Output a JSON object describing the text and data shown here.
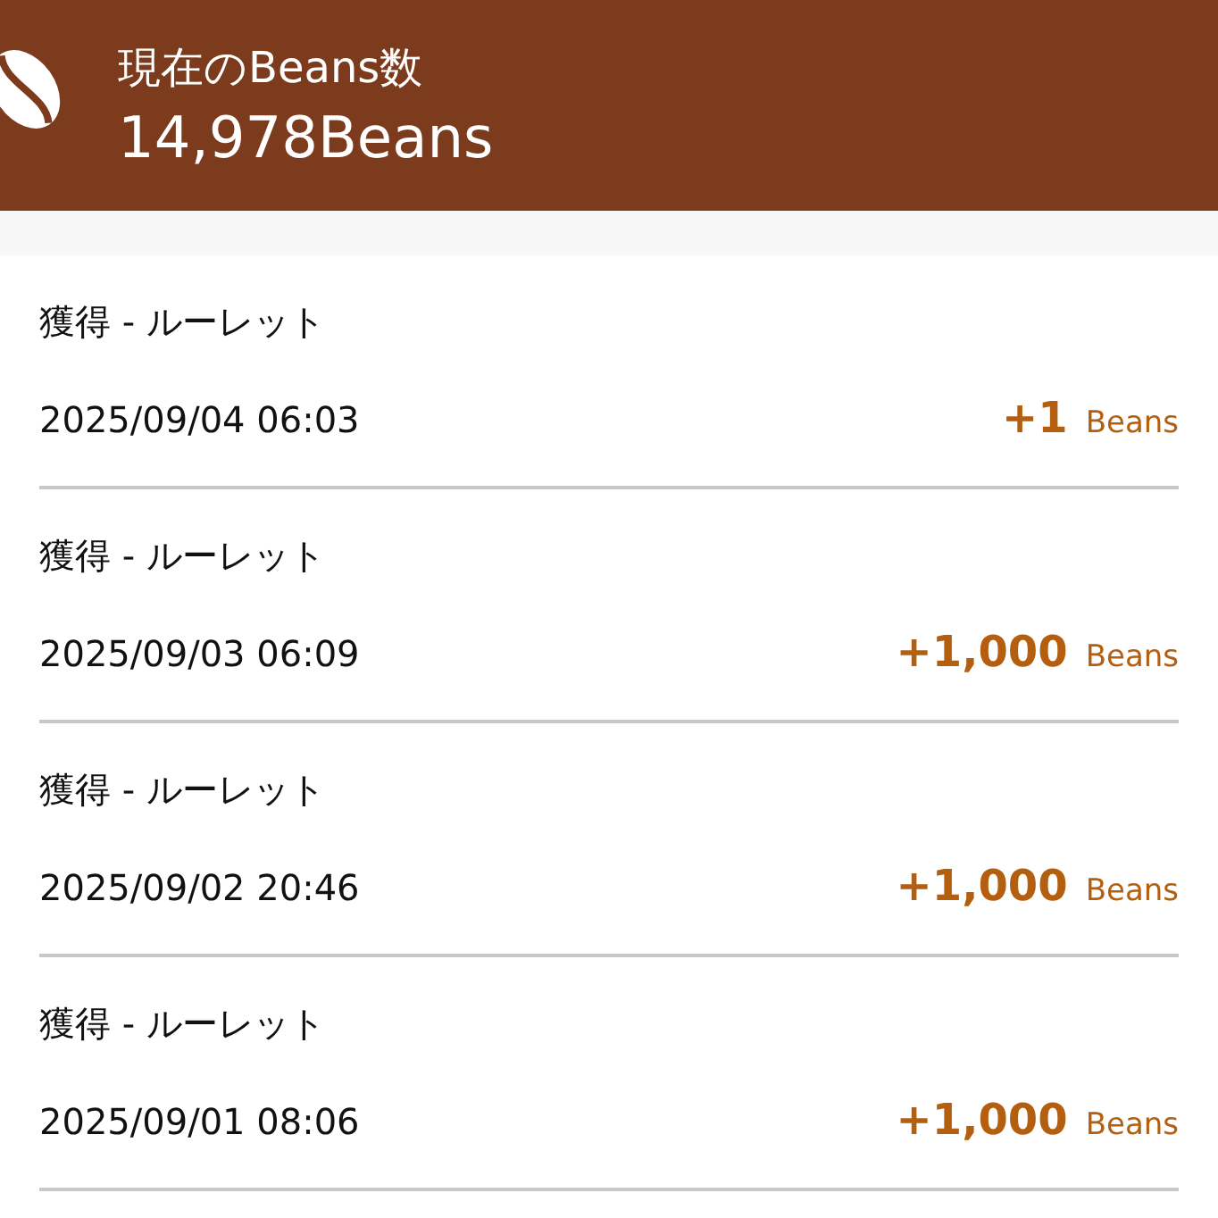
{
  "header": {
    "label": "現在のBeans数",
    "balance": "14,978Beans"
  },
  "history": [
    {
      "title": "獲得 - ルーレット",
      "date": "2025/09/04 06:03",
      "amount": "+1",
      "unit": "Beans"
    },
    {
      "title": "獲得 - ルーレット",
      "date": "2025/09/03 06:09",
      "amount": "+1,000",
      "unit": "Beans"
    },
    {
      "title": "獲得 - ルーレット",
      "date": "2025/09/02 20:46",
      "amount": "+1,000",
      "unit": "Beans"
    },
    {
      "title": "獲得 - ルーレット",
      "date": "2025/09/01 08:06",
      "amount": "+1,000",
      "unit": "Beans"
    }
  ]
}
